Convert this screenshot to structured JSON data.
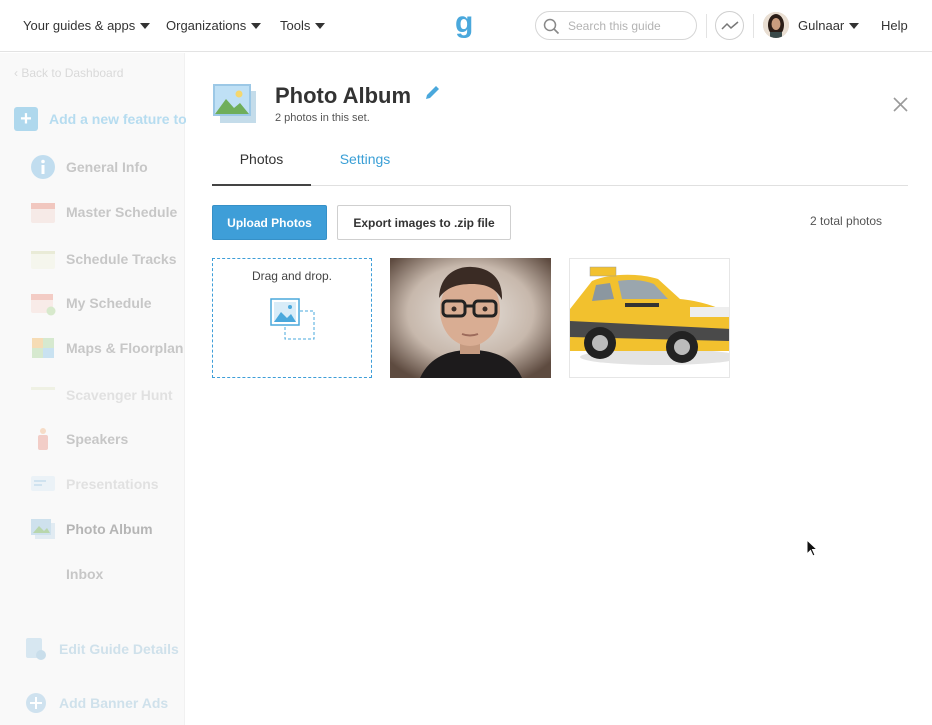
{
  "topnav": {
    "guides_apps": "Your guides & apps",
    "organizations": "Organizations",
    "tools": "Tools",
    "search_placeholder": "Search this guide",
    "user_name": "Gulnaar",
    "help": "Help"
  },
  "sidebar": {
    "back": "Back to Dashboard",
    "add_feature": "Add a new feature to",
    "items": [
      {
        "label": "General Info",
        "icon": "info-icon"
      },
      {
        "label": "Master Schedule",
        "icon": "calendar-icon"
      },
      {
        "label": "Schedule Tracks",
        "icon": "tracks-icon"
      },
      {
        "label": "My Schedule",
        "icon": "calendar-check-icon"
      },
      {
        "label": "Maps & Floorplan",
        "icon": "map-icon"
      },
      {
        "label": "Scavenger Hunt",
        "icon": "hunt-icon"
      },
      {
        "label": "Speakers",
        "icon": "speaker-icon"
      },
      {
        "label": "Presentations",
        "icon": "presentation-icon"
      },
      {
        "label": "Photo Album",
        "icon": "photo-album-icon"
      },
      {
        "label": "Inbox",
        "icon": "inbox-icon"
      }
    ],
    "edit_guide": "Edit Guide Details",
    "add_banner": "Add Banner Ads"
  },
  "panel": {
    "title": "Photo Album",
    "subtitle": "2 photos in this set.",
    "tabs": [
      "Photos",
      "Settings"
    ],
    "upload_button": "Upload Photos",
    "export_button": "Export images to .zip file",
    "total": "2 total photos",
    "dropzone_label": "Drag and drop."
  },
  "colors": {
    "accent": "#3e9ed8",
    "logo": "#4aa8dc",
    "taxi_yellow": "#f2c12e"
  }
}
